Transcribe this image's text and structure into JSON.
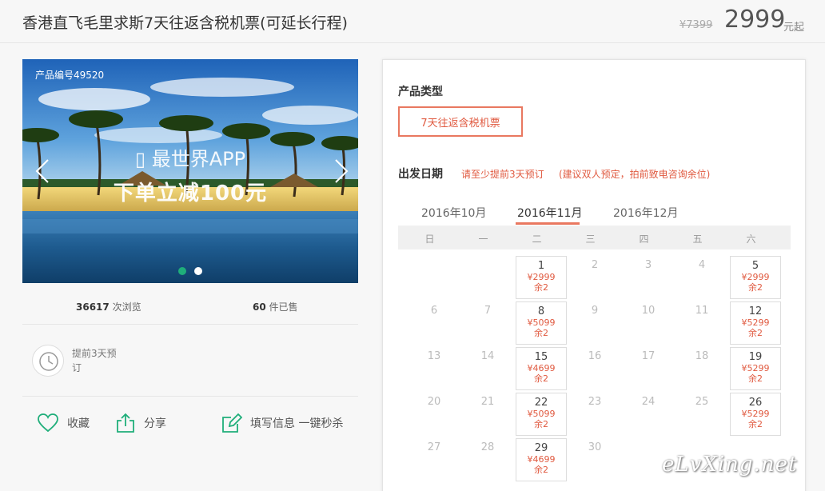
{
  "header": {
    "title": "香港直飞毛里求斯7天往返含税机票(可延长行程)",
    "original_price": "¥7399",
    "price": "2999",
    "price_unit": "元起"
  },
  "banner": {
    "product_code": "产品编号49520",
    "app_text": "最世界APP",
    "promo_text": "下单立减100元"
  },
  "stats": {
    "views_count": "36617",
    "views_label": "次浏览",
    "sold_count": "60",
    "sold_label": "件已售"
  },
  "advance": {
    "text": "提前3天预订"
  },
  "actions": {
    "favorite": "收藏",
    "share": "分享",
    "book": "填写信息 一键秒杀"
  },
  "panel": {
    "product_type_label": "产品类型",
    "product_type_option": "7天往返含税机票",
    "departure_label": "出发日期",
    "hint_advance": "请至少提前3天预订",
    "hint_contact": "(建议双人预定，拍前致电咨询余位)"
  },
  "calendar": {
    "months": [
      "2016年10月",
      "2016年11月",
      "2016年12月"
    ],
    "active_month": 1,
    "weekdays": [
      "日",
      "一",
      "二",
      "三",
      "四",
      "五",
      "六"
    ],
    "rows": [
      [
        null,
        null,
        {
          "day": "1",
          "price": "¥2999",
          "remain": "余2"
        },
        {
          "day": "2"
        },
        {
          "day": "3"
        },
        {
          "day": "4"
        },
        {
          "day": "5",
          "price": "¥2999",
          "remain": "余2"
        }
      ],
      [
        {
          "day": "6"
        },
        {
          "day": "7"
        },
        {
          "day": "8",
          "price": "¥5099",
          "remain": "余2"
        },
        {
          "day": "9"
        },
        {
          "day": "10"
        },
        {
          "day": "11"
        },
        {
          "day": "12",
          "price": "¥5299",
          "remain": "余2"
        }
      ],
      [
        {
          "day": "13"
        },
        {
          "day": "14"
        },
        {
          "day": "15",
          "price": "¥4699",
          "remain": "余2"
        },
        {
          "day": "16"
        },
        {
          "day": "17"
        },
        {
          "day": "18"
        },
        {
          "day": "19",
          "price": "¥5299",
          "remain": "余2"
        }
      ],
      [
        {
          "day": "20"
        },
        {
          "day": "21"
        },
        {
          "day": "22",
          "price": "¥5099",
          "remain": "余2"
        },
        {
          "day": "23"
        },
        {
          "day": "24"
        },
        {
          "day": "25"
        },
        {
          "day": "26",
          "price": "¥5299",
          "remain": "余2"
        }
      ],
      [
        {
          "day": "27"
        },
        {
          "day": "28"
        },
        {
          "day": "29",
          "price": "¥4699",
          "remain": "余2"
        },
        {
          "day": "30"
        },
        null,
        null,
        null
      ]
    ]
  },
  "watermark": "eLvXing.net",
  "colors": {
    "accent": "#e97860",
    "accent_text": "#e05a40",
    "green": "#1fae7a"
  }
}
